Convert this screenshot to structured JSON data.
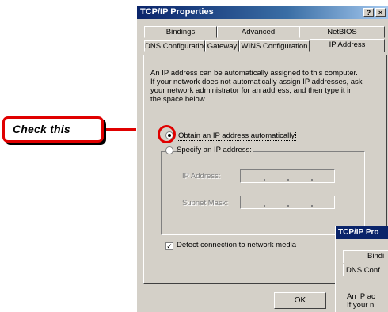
{
  "dialog": {
    "title": "TCP/IP Properties",
    "help_btn": "?",
    "close_btn": "×",
    "tabs_row1": [
      "Bindings",
      "Advanced",
      "NetBIOS"
    ],
    "tabs_row2": [
      "DNS Configuration",
      "Gateway",
      "WINS Configuration",
      "IP Address"
    ],
    "selected_tab": "IP Address",
    "description": "An IP address can be automatically assigned to this computer.\nIf your network does not automatically assign IP addresses, ask\nyour network administrator for an address, and then type it in\nthe space below.",
    "radio_obtain": "Obtain an IP address automatically",
    "radio_specify": "Specify an IP address:",
    "ip_address_label": "IP Address:",
    "subnet_mask_label": "Subnet Mask:",
    "detect_checkbox": "Detect connection to network media",
    "detect_checked": true,
    "ok_label": "OK"
  },
  "dialog2": {
    "title": "TCP/IP Pro",
    "tab_row1": "Bindi",
    "tab_row2": "DNS Conf",
    "desc_line1": "An IP ac",
    "desc_line2": "If your n"
  },
  "callout": {
    "text": "Check this",
    "color": "#e00000"
  }
}
